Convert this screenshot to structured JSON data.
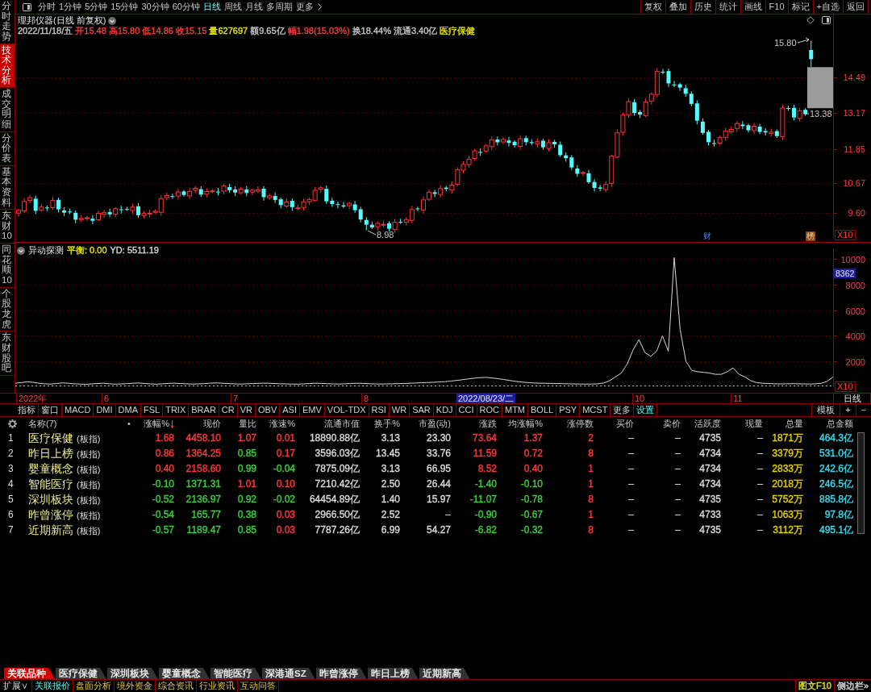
{
  "sidebar": {
    "tabs": [
      {
        "label": "分时走势",
        "selected": false
      },
      {
        "label": "技术分析",
        "selected": true
      },
      {
        "label": "成交明细",
        "selected": false
      },
      {
        "label": "分价表",
        "selected": false
      },
      {
        "label": "基本资料",
        "selected": false
      },
      {
        "label": "东财10",
        "selected": false
      },
      {
        "label": "同花顺10",
        "selected": false
      },
      {
        "label": "个股龙虎",
        "selected": false
      },
      {
        "label": "东财股吧",
        "selected": false
      }
    ]
  },
  "toolbar": {
    "periods": [
      {
        "label": "分时",
        "selected": false
      },
      {
        "label": "1分钟",
        "selected": false
      },
      {
        "label": "5分钟",
        "selected": false
      },
      {
        "label": "15分钟",
        "selected": false
      },
      {
        "label": "30分钟",
        "selected": false
      },
      {
        "label": "60分钟",
        "selected": false
      },
      {
        "label": "日线",
        "selected": true
      },
      {
        "label": "周线",
        "selected": false
      },
      {
        "label": "月线",
        "selected": false
      },
      {
        "label": "多周期",
        "selected": false
      },
      {
        "label": "更多",
        "selected": false
      }
    ],
    "buttons": [
      "复权",
      "叠加",
      "历史",
      "统计",
      "画线",
      "F10",
      "标记",
      "+自选",
      "返回"
    ]
  },
  "price_chart": {
    "title": "理邦仪器(日线 前复权)",
    "quote": [
      {
        "text": "2022/11/18/五",
        "color": "#c8c8c8"
      },
      {
        "text": "开15.48",
        "color": "#ff3c3c"
      },
      {
        "text": "高15.80",
        "color": "#ff3c3c"
      },
      {
        "text": "低14.86",
        "color": "#ff3c3c"
      },
      {
        "text": "收15.15",
        "color": "#ff3c3c"
      },
      {
        "text": "量627697",
        "color": "#e6e600"
      },
      {
        "text": "额9.65亿",
        "color": "#c8c8c8"
      },
      {
        "text": "幅1.98(15.03%)",
        "color": "#ff3c3c"
      },
      {
        "text": "换18.44%",
        "color": "#c8c8c8"
      },
      {
        "text": "流通3.40亿",
        "color": "#c8c8c8"
      },
      {
        "text": "医疗保健",
        "color": "#e6e600"
      }
    ],
    "axis_labels": [
      "14.49",
      "13.17",
      "11.85",
      "10.67",
      "9.60"
    ],
    "annotations": [
      "15.80",
      "13.38",
      "8.98"
    ],
    "markers": [
      {
        "text": "财",
        "kind": "news"
      },
      {
        "text": "榜",
        "kind": "rank"
      }
    ],
    "scale": "X10"
  },
  "indicator": {
    "title": "异动探测",
    "params": [
      {
        "text": "平衡: 0.00",
        "color": "#e6e600"
      },
      {
        "text": "YD: 5511.19",
        "color": "#dcdcdc"
      }
    ],
    "cursor_value": "8362",
    "scale": "X10",
    "chart_data": {
      "type": "line",
      "grid": true,
      "ylim": [
        0,
        10818
      ],
      "yticks": [
        2000,
        4000,
        6000,
        8000,
        10000
      ],
      "series": [
        {
          "color": "#d8d8d8",
          "values": [
            300,
            350,
            420,
            380,
            300,
            260,
            240,
            280,
            330,
            300,
            260,
            240,
            220,
            250,
            280,
            300,
            260,
            230,
            250,
            270,
            300,
            320,
            280,
            250,
            230,
            260,
            290,
            310,
            280,
            260,
            240,
            250,
            270,
            300,
            330,
            310,
            280,
            260,
            240,
            250,
            270,
            290,
            310,
            300,
            280,
            260,
            250,
            240,
            230,
            250,
            280,
            300,
            290,
            270,
            250,
            240,
            260,
            280,
            300,
            290,
            270,
            250,
            240,
            250,
            260,
            270,
            280,
            300,
            320,
            340,
            360,
            380,
            400,
            430,
            470,
            520,
            580,
            640,
            700,
            740,
            760,
            720,
            660,
            600,
            520,
            450,
            400,
            360,
            330,
            310,
            300,
            290,
            280,
            270,
            260,
            250,
            240,
            230,
            240,
            260,
            320,
            500,
            800,
            1100,
            1800,
            2900,
            3700,
            2700,
            2400,
            2800,
            4000,
            2800,
            10100,
            4500,
            2000,
            1300,
            1200,
            1150,
            1100,
            1000,
            1000,
            1200,
            1500,
            1000,
            800,
            500,
            350,
            300,
            280,
            260,
            250,
            260,
            270,
            260,
            250,
            240,
            260,
            300,
            450,
            800
          ]
        }
      ]
    }
  },
  "date_axis": {
    "labels": [
      "2022年",
      "6",
      "7",
      "8",
      "10",
      "11"
    ],
    "cursor_date": "2022/08/23/二",
    "period": "日线"
  },
  "indicator_bar": {
    "items": [
      "指标",
      "窗口",
      "MACD",
      "DMI",
      "DMA",
      "FSL",
      "TRIX",
      "BRAR",
      "CR",
      "VR",
      "OBV",
      "ASI",
      "EMV",
      "VOL-TDX",
      "RSI",
      "WR",
      "SAR",
      "KDJ",
      "CCI",
      "ROC",
      "MTM",
      "BOLL",
      "PSY",
      "MCST",
      "更多"
    ],
    "settings": "设置",
    "right_buttons": [
      "模板",
      "+",
      "−"
    ]
  },
  "table": {
    "columns": [
      {
        "label": "名称(7)",
        "sorted": false
      },
      {
        "label": "•",
        "sorted": false
      },
      {
        "label": "涨幅%",
        "sorted": true
      },
      {
        "label": "现价",
        "sorted": false
      },
      {
        "label": "量比",
        "sorted": false
      },
      {
        "label": "涨速%",
        "sorted": false
      },
      {
        "label": "流通市值",
        "sorted": false
      },
      {
        "label": "换手%",
        "sorted": false
      },
      {
        "label": "市盈(动)",
        "sorted": false
      },
      {
        "label": "涨跌",
        "sorted": false
      },
      {
        "label": "均涨幅%",
        "sorted": false
      },
      {
        "label": "涨停数",
        "sorted": false
      },
      {
        "label": "买价",
        "sorted": false
      },
      {
        "label": "卖价",
        "sorted": false
      },
      {
        "label": "活跃度",
        "sorted": false
      },
      {
        "label": "现量",
        "sorted": false
      },
      {
        "label": "总量",
        "sorted": false
      },
      {
        "label": "总金额",
        "sorted": false
      }
    ],
    "rows": [
      {
        "index": "1",
        "cells": [
          {
            "text": "医疗保健",
            "tag": "(板指)"
          },
          {
            "text": ""
          },
          {
            "text": "1.68",
            "color": "#ff3c3c"
          },
          {
            "text": "4458.10",
            "color": "#ff3c3c"
          },
          {
            "text": "1.07",
            "color": "#ff3c3c"
          },
          {
            "text": "0.01",
            "color": "#ff3c3c"
          },
          {
            "text": "18890.88亿",
            "color": "#dcdcdc"
          },
          {
            "text": "3.13",
            "color": "#dcdcdc"
          },
          {
            "text": "23.30",
            "color": "#dcdcdc"
          },
          {
            "text": "73.64",
            "color": "#ff3c3c"
          },
          {
            "text": "1.37",
            "color": "#ff3c3c"
          },
          {
            "text": "2",
            "color": "#ff3c3c"
          },
          {
            "text": "–",
            "color": "#dcdcdc"
          },
          {
            "text": "–",
            "color": "#dcdcdc"
          },
          {
            "text": "4735",
            "color": "#dcdcdc"
          },
          {
            "text": "–",
            "color": "#dcdcdc"
          },
          {
            "text": "1871万",
            "color": "#e6d200"
          },
          {
            "text": "464.3亿",
            "color": "#3cdcf0"
          }
        ]
      },
      {
        "index": "2",
        "cells": [
          {
            "text": "昨日上榜",
            "tag": "(板指)"
          },
          {
            "text": ""
          },
          {
            "text": "0.86",
            "color": "#ff3c3c"
          },
          {
            "text": "1364.25",
            "color": "#ff3c3c"
          },
          {
            "text": "0.85",
            "color": "#3cd23c"
          },
          {
            "text": "0.17",
            "color": "#ff3c3c"
          },
          {
            "text": "3596.03亿",
            "color": "#dcdcdc"
          },
          {
            "text": "13.45",
            "color": "#dcdcdc"
          },
          {
            "text": "33.76",
            "color": "#dcdcdc"
          },
          {
            "text": "11.59",
            "color": "#ff3c3c"
          },
          {
            "text": "0.72",
            "color": "#ff3c3c"
          },
          {
            "text": "8",
            "color": "#ff3c3c"
          },
          {
            "text": "–",
            "color": "#dcdcdc"
          },
          {
            "text": "–",
            "color": "#dcdcdc"
          },
          {
            "text": "4734",
            "color": "#dcdcdc"
          },
          {
            "text": "–",
            "color": "#dcdcdc"
          },
          {
            "text": "3379万",
            "color": "#e6d200"
          },
          {
            "text": "531.0亿",
            "color": "#3cdcf0"
          }
        ]
      },
      {
        "index": "3",
        "cells": [
          {
            "text": "婴童概念",
            "tag": "(板指)"
          },
          {
            "text": ""
          },
          {
            "text": "0.40",
            "color": "#ff3c3c"
          },
          {
            "text": "2158.60",
            "color": "#ff3c3c"
          },
          {
            "text": "0.99",
            "color": "#3cd23c"
          },
          {
            "text": "-0.04",
            "color": "#3cd23c"
          },
          {
            "text": "7875.09亿",
            "color": "#dcdcdc"
          },
          {
            "text": "3.13",
            "color": "#dcdcdc"
          },
          {
            "text": "66.95",
            "color": "#dcdcdc"
          },
          {
            "text": "8.52",
            "color": "#ff3c3c"
          },
          {
            "text": "0.40",
            "color": "#ff3c3c"
          },
          {
            "text": "1",
            "color": "#ff3c3c"
          },
          {
            "text": "–",
            "color": "#dcdcdc"
          },
          {
            "text": "–",
            "color": "#dcdcdc"
          },
          {
            "text": "4734",
            "color": "#dcdcdc"
          },
          {
            "text": "–",
            "color": "#dcdcdc"
          },
          {
            "text": "2833万",
            "color": "#e6d200"
          },
          {
            "text": "242.6亿",
            "color": "#3cdcf0"
          }
        ]
      },
      {
        "index": "4",
        "cells": [
          {
            "text": "智能医疗",
            "tag": "(板指)"
          },
          {
            "text": ""
          },
          {
            "text": "-0.10",
            "color": "#3cd23c"
          },
          {
            "text": "1371.31",
            "color": "#3cd23c"
          },
          {
            "text": "1.01",
            "color": "#ff3c3c"
          },
          {
            "text": "0.10",
            "color": "#ff3c3c"
          },
          {
            "text": "7210.42亿",
            "color": "#dcdcdc"
          },
          {
            "text": "2.50",
            "color": "#dcdcdc"
          },
          {
            "text": "26.44",
            "color": "#dcdcdc"
          },
          {
            "text": "-1.40",
            "color": "#3cd23c"
          },
          {
            "text": "-0.10",
            "color": "#3cd23c"
          },
          {
            "text": "1",
            "color": "#ff3c3c"
          },
          {
            "text": "–",
            "color": "#dcdcdc"
          },
          {
            "text": "–",
            "color": "#dcdcdc"
          },
          {
            "text": "4734",
            "color": "#dcdcdc"
          },
          {
            "text": "–",
            "color": "#dcdcdc"
          },
          {
            "text": "2018万",
            "color": "#e6d200"
          },
          {
            "text": "246.5亿",
            "color": "#3cdcf0"
          }
        ]
      },
      {
        "index": "5",
        "cells": [
          {
            "text": "深圳板块",
            "tag": "(板指)"
          },
          {
            "text": ""
          },
          {
            "text": "-0.52",
            "color": "#3cd23c"
          },
          {
            "text": "2136.97",
            "color": "#3cd23c"
          },
          {
            "text": "0.92",
            "color": "#3cd23c"
          },
          {
            "text": "-0.02",
            "color": "#3cd23c"
          },
          {
            "text": "64454.89亿",
            "color": "#dcdcdc"
          },
          {
            "text": "1.40",
            "color": "#dcdcdc"
          },
          {
            "text": "15.97",
            "color": "#dcdcdc"
          },
          {
            "text": "-11.07",
            "color": "#3cd23c"
          },
          {
            "text": "-0.78",
            "color": "#3cd23c"
          },
          {
            "text": "8",
            "color": "#ff3c3c"
          },
          {
            "text": "–",
            "color": "#dcdcdc"
          },
          {
            "text": "–",
            "color": "#dcdcdc"
          },
          {
            "text": "4735",
            "color": "#dcdcdc"
          },
          {
            "text": "–",
            "color": "#dcdcdc"
          },
          {
            "text": "5752万",
            "color": "#e6d200"
          },
          {
            "text": "885.8亿",
            "color": "#3cdcf0"
          }
        ]
      },
      {
        "index": "6",
        "cells": [
          {
            "text": "昨曾涨停",
            "tag": "(板指)"
          },
          {
            "text": ""
          },
          {
            "text": "-0.54",
            "color": "#3cd23c"
          },
          {
            "text": "165.77",
            "color": "#3cd23c"
          },
          {
            "text": "0.38",
            "color": "#3cd23c"
          },
          {
            "text": "0.03",
            "color": "#ff3c3c"
          },
          {
            "text": "2966.50亿",
            "color": "#dcdcdc"
          },
          {
            "text": "2.52",
            "color": "#dcdcdc"
          },
          {
            "text": "–",
            "color": "#dcdcdc"
          },
          {
            "text": "-0.90",
            "color": "#3cd23c"
          },
          {
            "text": "-0.67",
            "color": "#3cd23c"
          },
          {
            "text": "1",
            "color": "#ff3c3c"
          },
          {
            "text": "–",
            "color": "#dcdcdc"
          },
          {
            "text": "–",
            "color": "#dcdcdc"
          },
          {
            "text": "4733",
            "color": "#dcdcdc"
          },
          {
            "text": "–",
            "color": "#dcdcdc"
          },
          {
            "text": "1063万",
            "color": "#e6d200"
          },
          {
            "text": "97.8亿",
            "color": "#3cdcf0"
          }
        ]
      },
      {
        "index": "7",
        "cells": [
          {
            "text": "近期新高",
            "tag": "(板指)"
          },
          {
            "text": ""
          },
          {
            "text": "-0.57",
            "color": "#3cd23c"
          },
          {
            "text": "1189.47",
            "color": "#3cd23c"
          },
          {
            "text": "0.85",
            "color": "#3cd23c"
          },
          {
            "text": "0.03",
            "color": "#ff3c3c"
          },
          {
            "text": "7787.26亿",
            "color": "#dcdcdc"
          },
          {
            "text": "6.99",
            "color": "#dcdcdc"
          },
          {
            "text": "54.27",
            "color": "#dcdcdc"
          },
          {
            "text": "-6.82",
            "color": "#3cd23c"
          },
          {
            "text": "-0.32",
            "color": "#3cd23c"
          },
          {
            "text": "8",
            "color": "#ff3c3c"
          },
          {
            "text": "–",
            "color": "#dcdcdc"
          },
          {
            "text": "–",
            "color": "#dcdcdc"
          },
          {
            "text": "4735",
            "color": "#dcdcdc"
          },
          {
            "text": "–",
            "color": "#dcdcdc"
          },
          {
            "text": "3112万",
            "color": "#e6d200"
          },
          {
            "text": "495.1亿",
            "color": "#3cdcf0"
          }
        ]
      }
    ]
  },
  "bottom_tabs": [
    {
      "label": "关联品种",
      "selected": true
    },
    {
      "label": "医疗保健",
      "selected": false
    },
    {
      "label": "深圳板块",
      "selected": false
    },
    {
      "label": "婴童概念",
      "selected": false
    },
    {
      "label": "智能医疗",
      "selected": false
    },
    {
      "label": "深港通SZ",
      "selected": false
    },
    {
      "label": "昨曾涨停",
      "selected": false
    },
    {
      "label": "昨日上榜",
      "selected": false
    },
    {
      "label": "近期新高",
      "selected": false
    }
  ],
  "status_bar": {
    "expand": "扩展∨",
    "items": [
      {
        "label": "关联报价",
        "selected": true
      },
      {
        "label": "盘面分析",
        "selected": false
      },
      {
        "label": "境外资金",
        "selected": false
      },
      {
        "label": "综合资讯",
        "selected": false
      },
      {
        "label": "行业资讯",
        "selected": false
      },
      {
        "label": "互动问答",
        "selected": false
      }
    ],
    "right": [
      {
        "label": "图文F10",
        "color": "#e6e600"
      },
      {
        "label": "侧边栏»",
        "color": "#dcdcdc"
      }
    ]
  }
}
